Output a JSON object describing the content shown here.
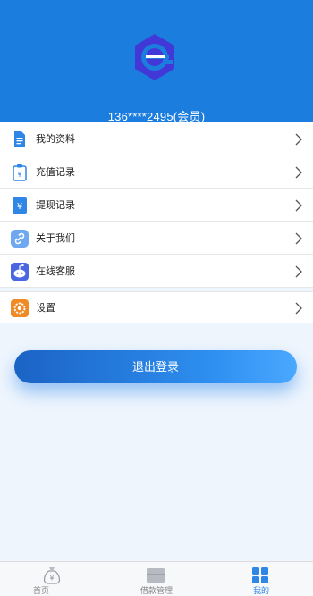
{
  "profile": {
    "user_text": "136****2495(会员)",
    "logo_icon": "brand-e-logo-icon"
  },
  "menu": {
    "items": [
      {
        "label": "我的资料",
        "icon": "profile-doc-icon"
      },
      {
        "label": "充值记录",
        "icon": "recharge-record-icon"
      },
      {
        "label": "提现记录",
        "icon": "withdraw-record-icon"
      },
      {
        "label": "关于我们",
        "icon": "link-icon"
      },
      {
        "label": "在线客服",
        "icon": "customer-service-icon"
      }
    ],
    "settings": {
      "label": "设置",
      "icon": "settings-icon"
    }
  },
  "logout": {
    "label": "退出登录"
  },
  "tabbar": {
    "tabs": [
      {
        "label": "首页",
        "icon": "money-bag-icon",
        "active": false
      },
      {
        "label": "借款管理",
        "icon": "loan-box-icon",
        "active": false
      },
      {
        "label": "我的",
        "icon": "grid-icon",
        "active": true
      }
    ]
  },
  "colors": {
    "header": "#1b7ddd",
    "accent": "#2f86e6",
    "logo": "#4238d8"
  }
}
